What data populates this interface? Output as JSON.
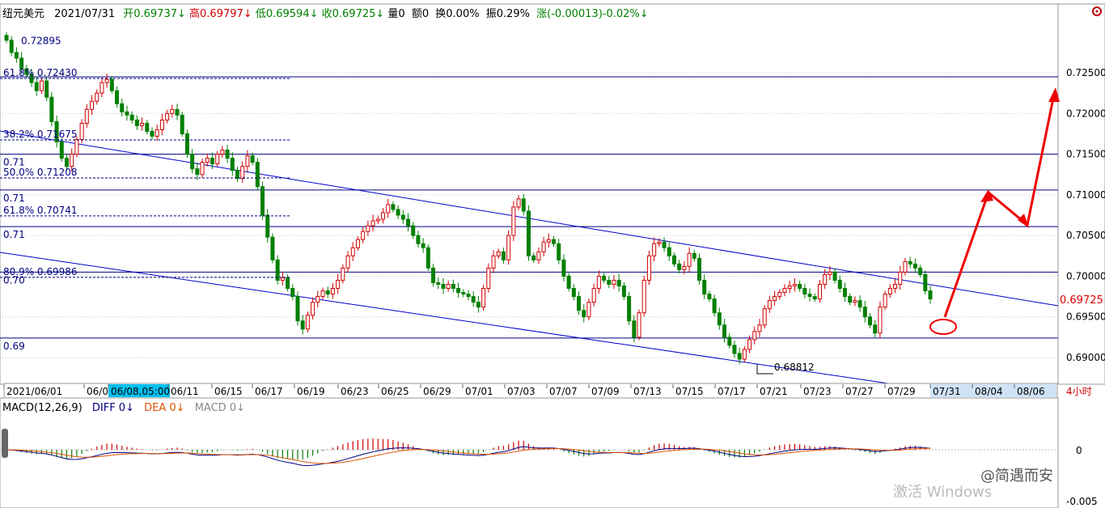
{
  "header": {
    "symbol": "纽元美元",
    "date": "2021/07/31",
    "open_label": "开0.69737↓",
    "high_label": "高0.69797↓",
    "low_label": "低0.69594↓",
    "close_label": "收0.69725↓",
    "volume_label": "量0",
    "amount_label": "额0",
    "turnover_label": "换0.00%",
    "amplitude_label": "振0.29%",
    "change_label": "涨(-0.00013)-0.02%↓"
  },
  "colors": {
    "up": "#d00000",
    "down": "#008000",
    "fib_line": "#000080",
    "channel": "#0000cc",
    "price_tag": "#e00000",
    "diff": "#000080",
    "dea": "#e05000",
    "macd": "#888888",
    "arrow": "#ee0000",
    "axis_highlight": "#00c0f0"
  },
  "chart_data": [
    {
      "type": "candlestick",
      "timeframe": "4小时",
      "ylim": [
        0.6875,
        0.7305
      ],
      "y_ticks": [
        "0.72500",
        "0.72000",
        "0.71500",
        "0.71000",
        "0.70500",
        "0.70000",
        "0.69500",
        "0.69000"
      ],
      "x_ticks": [
        "2021/06/01",
        "06/03",
        "06/08,05:00",
        "06/11",
        "06/15",
        "06/17",
        "06/19",
        "06/23",
        "06/25",
        "06/29",
        "07/01",
        "07/03",
        "07/07",
        "07/09",
        "07/13",
        "07/15",
        "07/17",
        "07/21",
        "07/23",
        "07/27",
        "07/29",
        "07/31",
        "08/04",
        "08/06"
      ],
      "highlighted_x_tick": "06/08,05:00",
      "last_price": "0.69725",
      "fib_levels": [
        {
          "label": "0.72895",
          "value": 0.72895
        },
        {
          "label": "61.8% 0.72430",
          "value": 0.7243
        },
        {
          "label": "38.2% 0.71675",
          "value": 0.71675
        },
        {
          "label": "50.0% 0.71208",
          "value": 0.71208
        },
        {
          "label": "61.8% 0.70741",
          "value": 0.70741
        },
        {
          "label": "80.9% 0.69986",
          "value": 0.69986
        }
      ],
      "horizontal_lines": [
        {
          "label": "",
          "value": 0.7245
        },
        {
          "label": "0.71",
          "value": 0.715
        },
        {
          "label": "0.71",
          "value": 0.7106
        },
        {
          "label": "0.71",
          "value": 0.7061
        },
        {
          "label": "0.70",
          "value": 0.7005
        },
        {
          "label": "0.69",
          "value": 0.6924
        }
      ],
      "low_annotation": "0.68812",
      "ohlc_path": [
        0.729,
        0.7275,
        0.7268,
        0.7255,
        0.7248,
        0.7238,
        0.7228,
        0.724,
        0.722,
        0.719,
        0.7165,
        0.7145,
        0.7135,
        0.715,
        0.7168,
        0.7188,
        0.7205,
        0.7215,
        0.7225,
        0.7238,
        0.7242,
        0.7228,
        0.7212,
        0.7202,
        0.7198,
        0.7192,
        0.7185,
        0.7188,
        0.7178,
        0.7172,
        0.718,
        0.7192,
        0.72,
        0.7205,
        0.7198,
        0.7175,
        0.715,
        0.7132,
        0.7125,
        0.714,
        0.7145,
        0.7138,
        0.715,
        0.7155,
        0.7145,
        0.713,
        0.712,
        0.7135,
        0.7148,
        0.714,
        0.711,
        0.7075,
        0.7048,
        0.702,
        0.6995,
        0.6998,
        0.6985,
        0.6975,
        0.6945,
        0.6935,
        0.6952,
        0.6968,
        0.6975,
        0.6982,
        0.6978,
        0.6985,
        0.6995,
        0.701,
        0.7025,
        0.7035,
        0.7045,
        0.7055,
        0.7062,
        0.7068,
        0.707,
        0.7078,
        0.7088,
        0.7082,
        0.7075,
        0.707,
        0.7062,
        0.705,
        0.704,
        0.7035,
        0.701,
        0.6992,
        0.699,
        0.6985,
        0.699,
        0.6985,
        0.698,
        0.6978,
        0.6975,
        0.6968,
        0.6962,
        0.6985,
        0.701,
        0.7025,
        0.703,
        0.702,
        0.705,
        0.7085,
        0.7095,
        0.708,
        0.7025,
        0.702,
        0.703,
        0.7042,
        0.7045,
        0.704,
        0.702,
        0.7,
        0.6985,
        0.6975,
        0.6958,
        0.695,
        0.6968,
        0.6985,
        0.7,
        0.6995,
        0.699,
        0.6995,
        0.6988,
        0.6975,
        0.6945,
        0.6925,
        0.6955,
        0.6995,
        0.7025,
        0.704,
        0.7042,
        0.7035,
        0.7025,
        0.7015,
        0.7008,
        0.7012,
        0.7028,
        0.7022,
        0.6995,
        0.6978,
        0.6972,
        0.6955,
        0.694,
        0.6925,
        0.6915,
        0.6905,
        0.6898,
        0.691,
        0.6922,
        0.6932,
        0.694,
        0.696,
        0.697,
        0.6975,
        0.698,
        0.6985,
        0.6988,
        0.699,
        0.6985,
        0.6978,
        0.6975,
        0.6972,
        0.699,
        0.7002,
        0.7005,
        0.6995,
        0.6985,
        0.6975,
        0.6968,
        0.697,
        0.6962,
        0.695,
        0.694,
        0.693,
        0.6962,
        0.6978,
        0.6985,
        0.699,
        0.7005,
        0.7018,
        0.7015,
        0.701,
        0.7002,
        0.6982,
        0.6972
      ]
    },
    {
      "type": "macd",
      "title": "MACD(12,26,9)",
      "diff_label": "DIFF 0↓",
      "dea_label": "DEA 0↓",
      "macd_label": "MACD 0↓",
      "zero_tick": "0",
      "low_tick": "-0.005"
    }
  ],
  "projection": {
    "points": [
      [
        0.69725,
        "07/31"
      ],
      [
        0.71,
        "08/04"
      ],
      [
        0.7065,
        "08/06"
      ],
      [
        0.7228,
        "08/06"
      ]
    ],
    "note_target": "0.72500"
  },
  "watermark": {
    "brand": "@简遇而安",
    "os": "激活 Windows"
  }
}
